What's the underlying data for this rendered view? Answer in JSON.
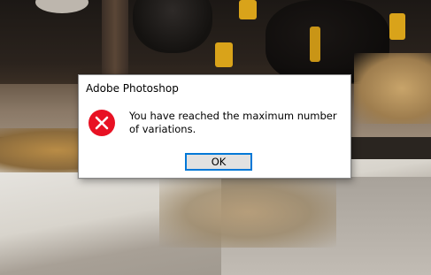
{
  "dialog": {
    "title": "Adobe Photoshop",
    "icon": "error-icon",
    "message": "You have reached the maximum number of variations.",
    "ok_label": "OK"
  },
  "colors": {
    "error_icon": "#e81123",
    "button_focus": "#0078d7",
    "button_bg": "#e1e1e1",
    "dialog_bg": "#ffffff"
  }
}
